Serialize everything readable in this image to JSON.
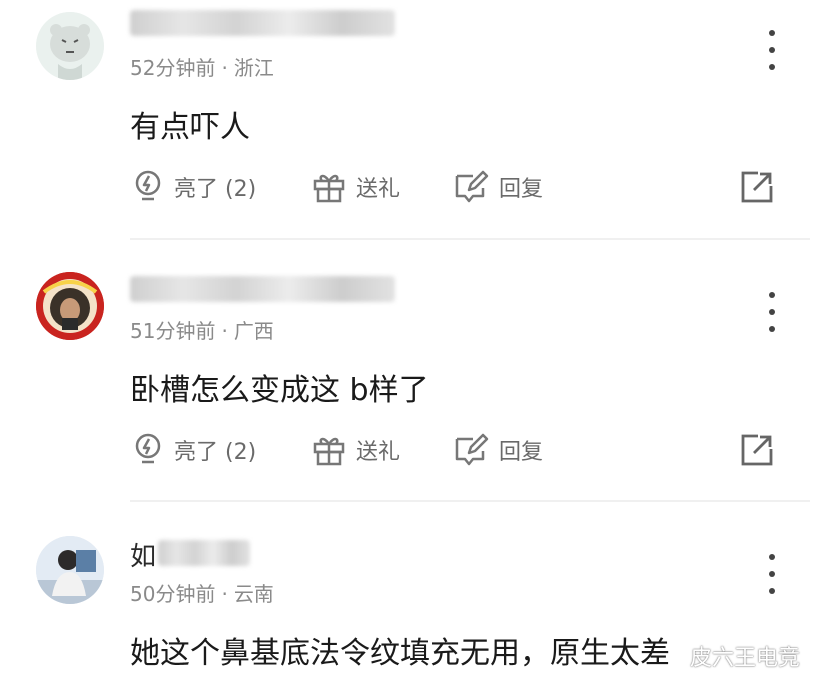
{
  "comments": [
    {
      "username": "",
      "username_initial": "",
      "time": "52分钟前",
      "location": "浙江",
      "text": "有点吓人",
      "like_label": "亮了 (2)",
      "gift_label": "送礼",
      "reply_label": "回复"
    },
    {
      "username": "",
      "username_initial": "",
      "time": "51分钟前",
      "location": "广西",
      "text": "卧槽怎么变成这 b样了",
      "like_label": "亮了 (2)",
      "gift_label": "送礼",
      "reply_label": "回复"
    },
    {
      "username": "",
      "username_initial": "如",
      "time": "50分钟前",
      "location": "云南",
      "text": "她这个鼻基底法令纹填充无用，原生太差",
      "like_label": "",
      "gift_label": "",
      "reply_label": ""
    }
  ],
  "separator": "·",
  "watermark": "皮六王电竞",
  "icons": {
    "more": "more-vertical-icon",
    "like": "lightbulb-icon",
    "gift": "gift-icon",
    "reply": "edit-reply-icon",
    "share": "share-external-icon"
  },
  "colors": {
    "text_primary": "#1a1a1a",
    "text_secondary": "#8a8a8a",
    "action_gray": "#6a6a6a",
    "divider": "#f0f0f0"
  }
}
